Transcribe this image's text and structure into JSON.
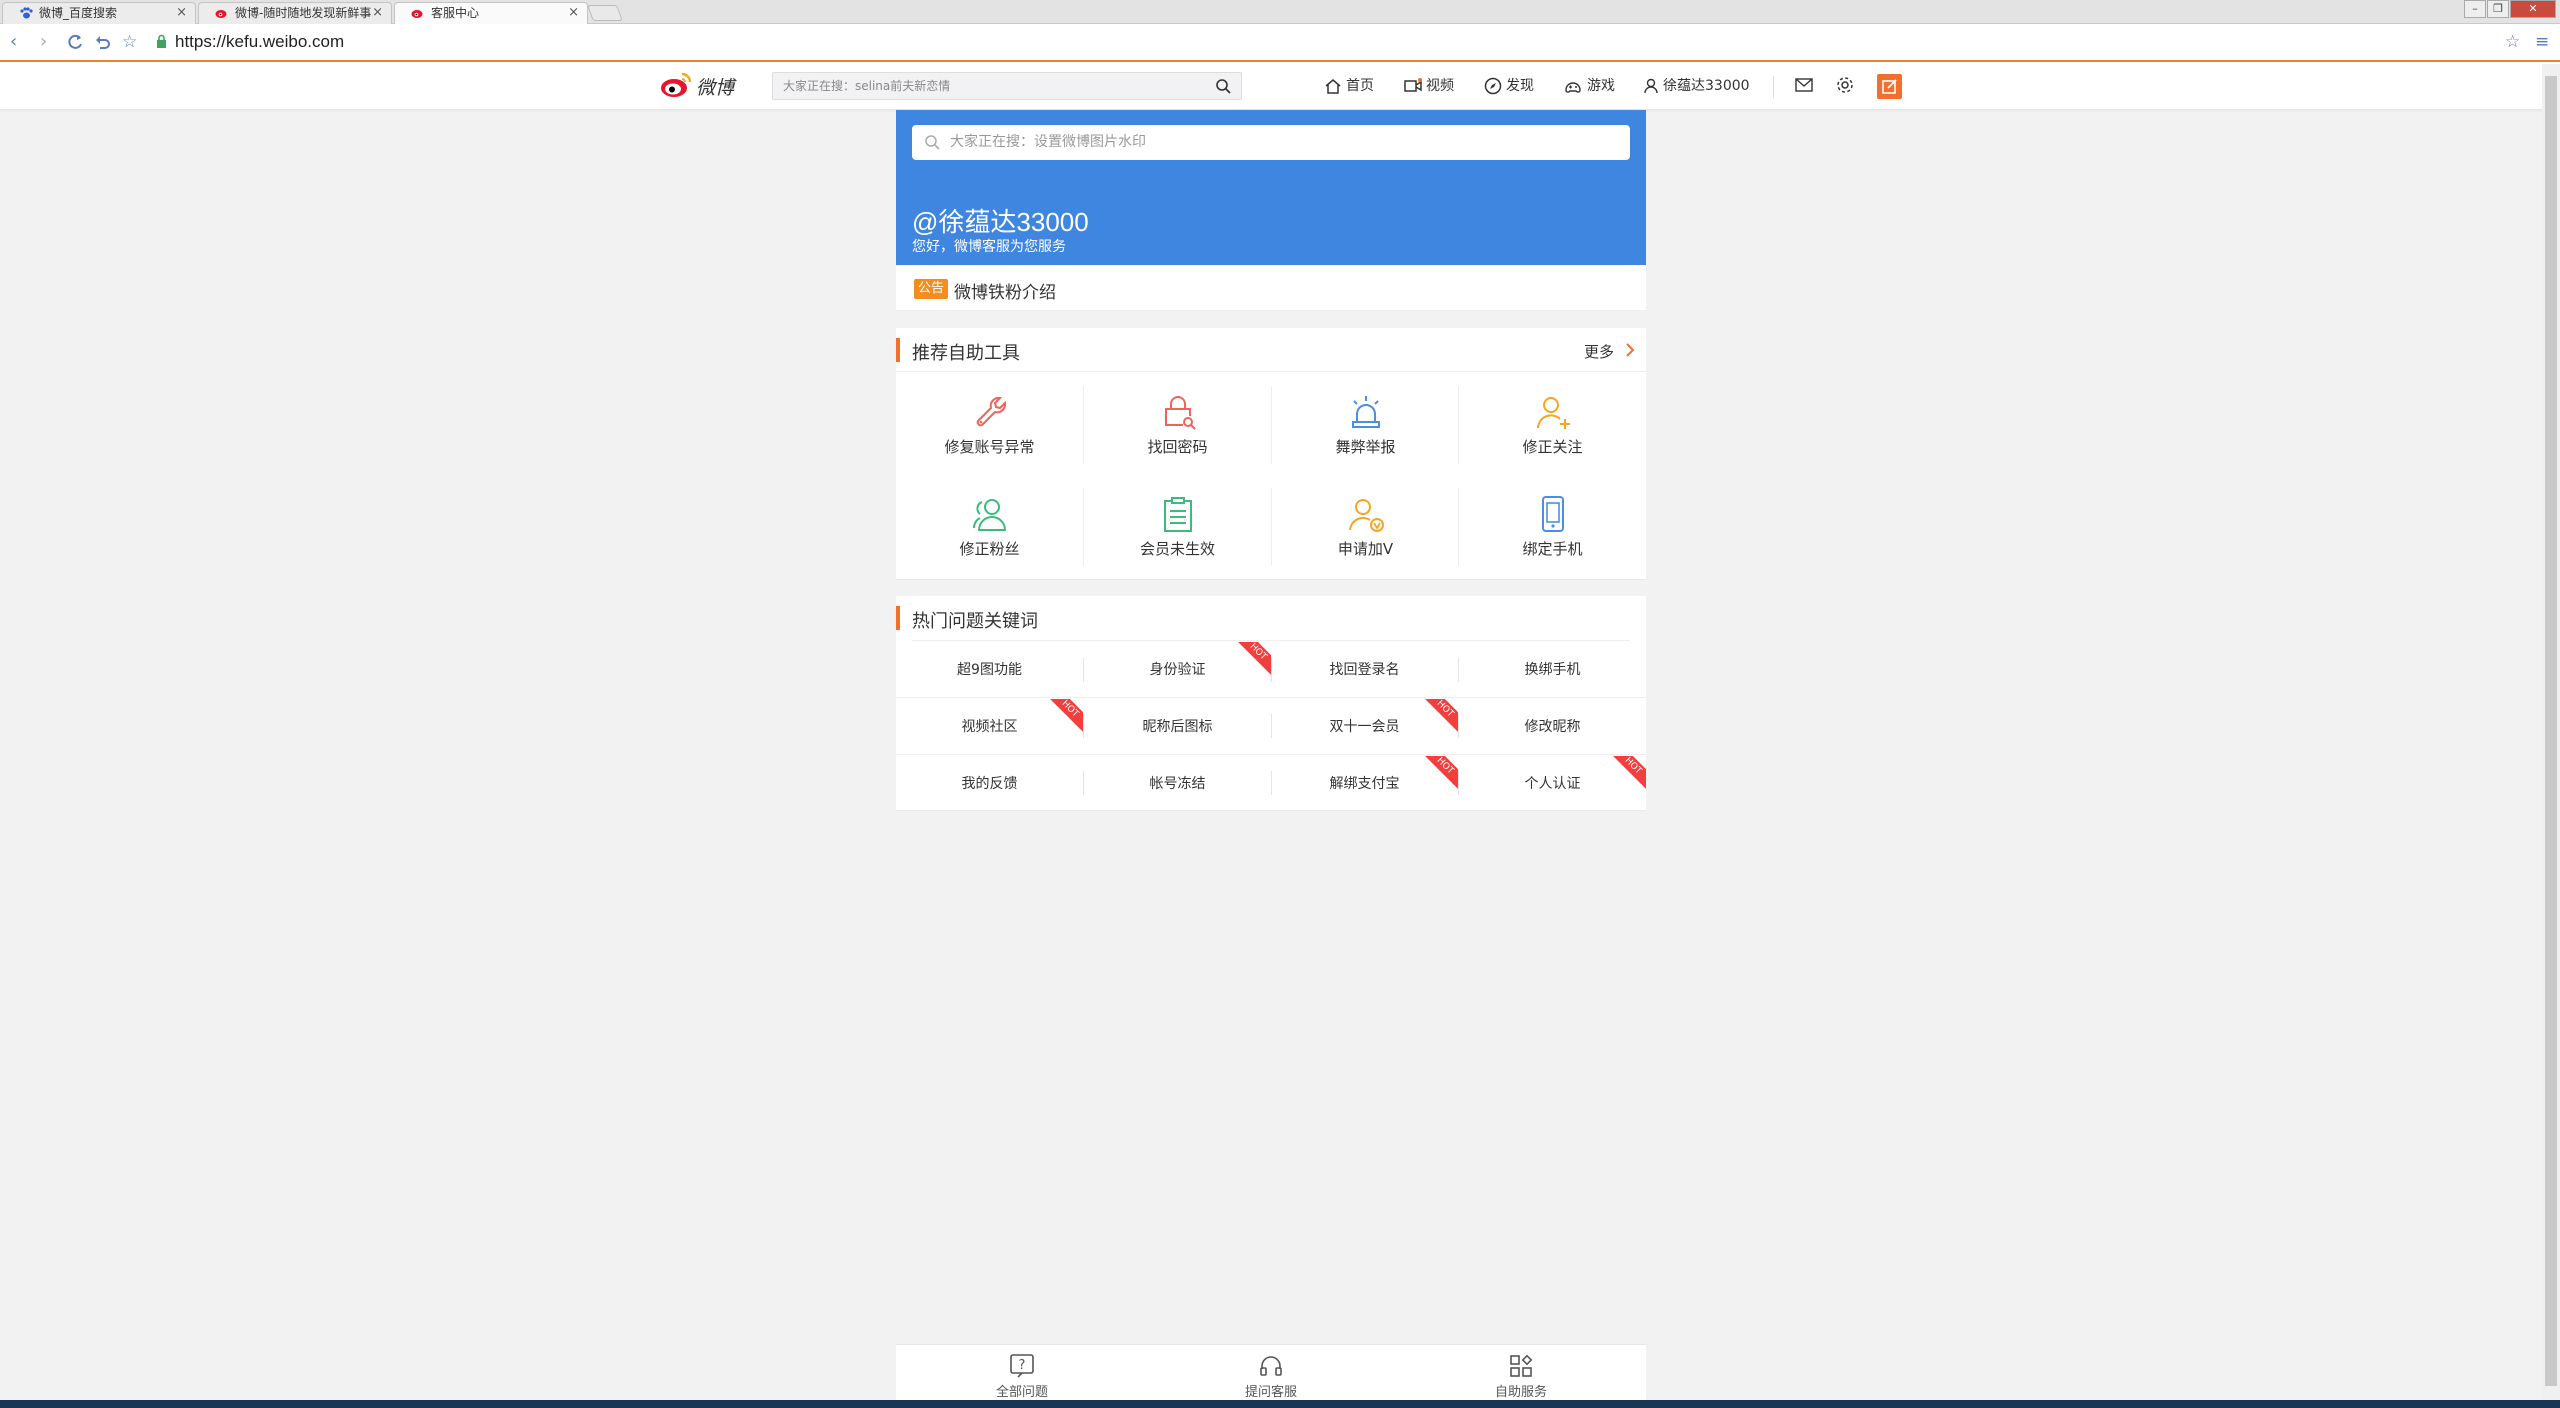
{
  "browser": {
    "tabs": [
      {
        "title": "微博_百度搜索",
        "icon": "baidu-paw-icon",
        "active": false
      },
      {
        "title": "微博-随时随地发现新鲜事",
        "icon": "weibo-icon",
        "active": false
      },
      {
        "title": "客服中心",
        "icon": "weibo-icon",
        "active": true
      }
    ],
    "url": "https://kefu.weibo.com"
  },
  "header": {
    "logo_text": "微博",
    "search_placeholder": "大家正在搜：selina前夫新恋情",
    "nav": {
      "home": "首页",
      "video": "视频",
      "discover": "发现",
      "games": "游戏",
      "user": "徐蕴达33000"
    }
  },
  "hero": {
    "search_placeholder": "大家正在搜：设置微博图片水印",
    "username": "@徐蕴达33000",
    "greeting": "您好，微博客服为您服务"
  },
  "notice": {
    "badge": "公告",
    "text": "微博铁粉介绍"
  },
  "tools": {
    "title": "推荐自助工具",
    "more": "更多",
    "items": [
      {
        "label": "修复账号异常",
        "icon": "wrench-icon",
        "color": "#f0635b"
      },
      {
        "label": "找回密码",
        "icon": "lock-search-icon",
        "color": "#f0635b"
      },
      {
        "label": "舞弊举报",
        "icon": "alarm-icon",
        "color": "#4a8fe0"
      },
      {
        "label": "修正关注",
        "icon": "user-add-icon",
        "color": "#f5a623"
      },
      {
        "label": "修正粉丝",
        "icon": "users-icon",
        "color": "#3dbb7b"
      },
      {
        "label": "会员未生效",
        "icon": "clipboard-icon",
        "color": "#3dbb7b"
      },
      {
        "label": "申请加V",
        "icon": "user-v-icon",
        "color": "#f5a623"
      },
      {
        "label": "绑定手机",
        "icon": "phone-icon",
        "color": "#4a8fe0"
      }
    ]
  },
  "hot": {
    "title": "热门问题关键词",
    "hot_label": "HOT",
    "items": [
      {
        "label": "超9图功能",
        "hot": false
      },
      {
        "label": "身份验证",
        "hot": true
      },
      {
        "label": "找回登录名",
        "hot": false
      },
      {
        "label": "换绑手机",
        "hot": false
      },
      {
        "label": "视频社区",
        "hot": true
      },
      {
        "label": "昵称后图标",
        "hot": false
      },
      {
        "label": "双十一会员",
        "hot": true
      },
      {
        "label": "修改昵称",
        "hot": false
      },
      {
        "label": "我的反馈",
        "hot": false
      },
      {
        "label": "帐号冻结",
        "hot": false
      },
      {
        "label": "解绑支付宝",
        "hot": true
      },
      {
        "label": "个人认证",
        "hot": true
      }
    ]
  },
  "bottom_nav": [
    {
      "label": "全部问题",
      "icon": "question-icon"
    },
    {
      "label": "提问客服",
      "icon": "headset-icon"
    },
    {
      "label": "自助服务",
      "icon": "grid-icon"
    }
  ],
  "colors": {
    "accent": "#f46f2b",
    "hero_blue": "#3f86e0",
    "hot_red": "#f33e3e",
    "notice_orange": "#f38d1e"
  }
}
